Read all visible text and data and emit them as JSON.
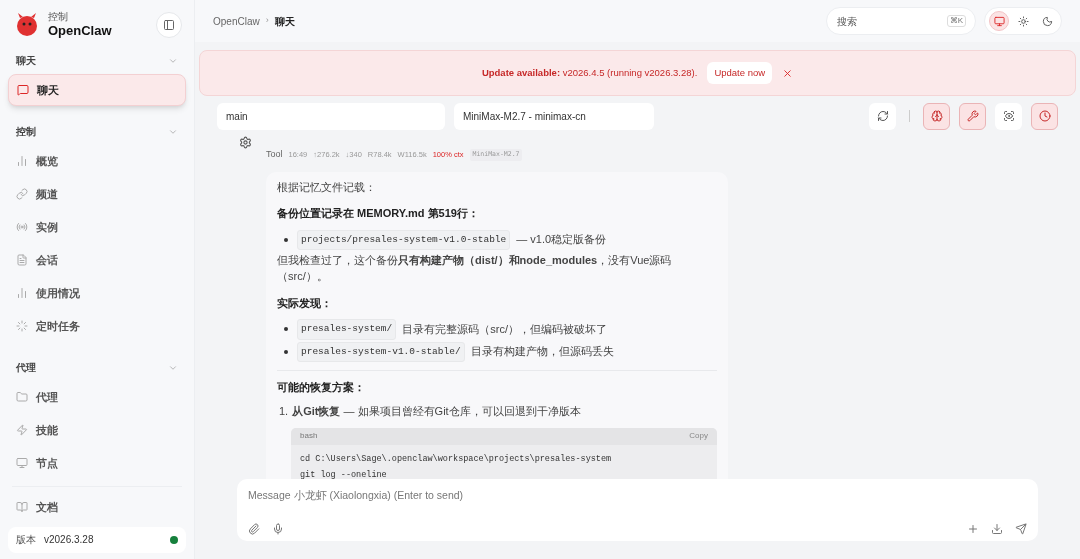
{
  "brand": {
    "subtitle": "控制",
    "title": "OpenClaw"
  },
  "sidebar": {
    "groups": [
      {
        "label": "聊天",
        "expanded": true,
        "items": [
          {
            "label": "聊天",
            "selected": true
          }
        ]
      },
      {
        "label": "控制",
        "expanded": true,
        "items": [
          {
            "label": "概览",
            "selected": false
          },
          {
            "label": "频道",
            "selected": false
          },
          {
            "label": "实例",
            "selected": false
          },
          {
            "label": "会话",
            "selected": false
          },
          {
            "label": "使用情况",
            "selected": false
          },
          {
            "label": "定时任务",
            "selected": false
          }
        ]
      },
      {
        "label": "代理",
        "expanded": true,
        "items": [
          {
            "label": "代理",
            "selected": false
          },
          {
            "label": "技能",
            "selected": false
          },
          {
            "label": "节点",
            "selected": false
          }
        ]
      }
    ],
    "docs": "文档",
    "version_label": "版本",
    "version": "v2026.3.28",
    "online": true
  },
  "breadcrumb": [
    "OpenClaw",
    "聊天"
  ],
  "breadcrumb_separator": "›",
  "search": {
    "placeholder": "搜索",
    "shortcut": "⌘K"
  },
  "theme_buttons": [
    {
      "selected": true
    },
    {
      "selected": false
    },
    {
      "selected": false
    }
  ],
  "banner": {
    "text": "**Update available:** v2026.4.5 (running v2026.3.28).",
    "button": "Update now"
  },
  "session": {
    "agent": "main",
    "model": "MiniMax-M2.7 - minimax-cn"
  },
  "toolbar": [
    {
      "on": false
    },
    {
      "on": true
    },
    {
      "on": true
    },
    {
      "on": false
    },
    {
      "on": true
    }
  ],
  "message": {
    "sender": "Tool",
    "time": "16:49",
    "stats": [
      "↑276.2k",
      "↓340",
      "R78.4k",
      "W116.5k"
    ],
    "ctx": "100% ctx",
    "model": "MiniMax-M2.7",
    "blocks": [
      {
        "kind": "paragraph",
        "text": "根据记忆文件记载："
      },
      {
        "kind": "heading",
        "text": "备份位置记录在 MEMORY.md 第519行："
      },
      {
        "kind": "bullets",
        "items": [
          {
            "code": "projects/presales-system-v1.0-stable",
            "text": "— v1.0稳定版备份"
          }
        ]
      },
      {
        "kind": "tight",
        "text": "但我检查过了，这个备份**只有构建产物（dist/）和node_modules**，没有Vue源码（src/）。"
      },
      {
        "kind": "heading",
        "text": "实际发现："
      },
      {
        "kind": "bullets",
        "items": [
          {
            "code": "presales-system/",
            "text": "目录有完整源码（src/），但编码被破坏了"
          },
          {
            "code": "presales-system-v1.0-stable/",
            "text": "目录有构建产物，但源码丢失"
          }
        ]
      },
      {
        "kind": "divider"
      },
      {
        "kind": "heading",
        "text": "可能的恢复方案："
      },
      {
        "kind": "ordered",
        "items": [
          {
            "number": "1.",
            "text": "**从Git恢复** — 如果项目曾经有Git仓库，可以回退到干净版本",
            "code": {
              "lang": "bash",
              "copy": "Copy",
              "lines": [
                "cd C:\\Users\\Sage\\.openclaw\\workspace\\projects\\presales-system",
                "git log --oneline"
              ]
            }
          }
        ]
      }
    ]
  },
  "composer": {
    "placeholder": "Message 小龙虾 (Xiaolongxia) (Enter to send)"
  }
}
